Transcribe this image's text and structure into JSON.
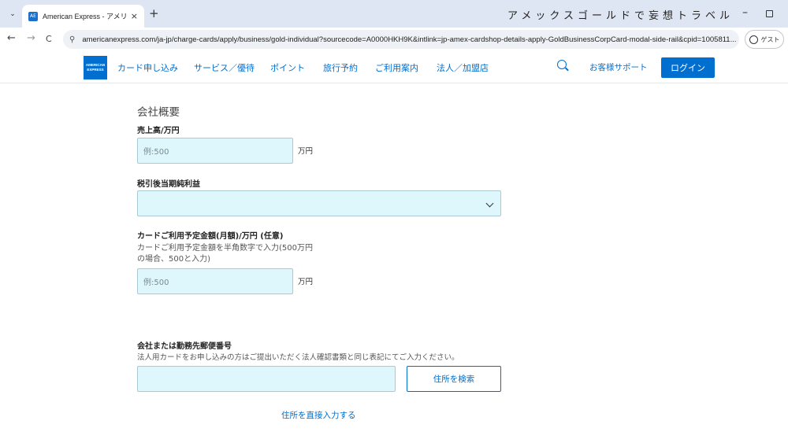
{
  "browser": {
    "tab_title": "American Express - アメリカン･エ",
    "favicon_text": "AE",
    "tab_close": "×",
    "new_tab": "+",
    "banner_text": "アメックスゴールドで妄想トラベル",
    "url": "americanexpress.com/ja-jp/charge-cards/apply/business/gold-individual?sourcecode=A0000HKH9K&intlink=jp-amex-cardshop-details-apply-GoldBusinessCorpCard-modal-side-rail&cpid=1005811...",
    "guest_label": "ゲスト",
    "win_min": "–",
    "back": "←",
    "forward": "→",
    "reload": "C",
    "tab_menu": "⌄",
    "tune": "⚲"
  },
  "header": {
    "logo_line1": "AMERICAN",
    "logo_line2": "EXPRESS",
    "nav": [
      "カード申し込み",
      "サービス／優待",
      "ポイント",
      "旅行予約",
      "ご利用案内",
      "法人／加盟店"
    ],
    "support": "お客様サポート",
    "login": "ログイン"
  },
  "form": {
    "section_heading": "会社概要",
    "sales": {
      "label": "売上高/万円",
      "placeholder": "例:500",
      "unit": "万円"
    },
    "net_income": {
      "label": "税引後当期純利益",
      "value": ""
    },
    "card_usage": {
      "label": "カードご利用予定金額(月額)/万円 (任意)",
      "hint_line1": "カードご利用予定金額を半角数字で入力(500万円",
      "hint_line2": "の場合、500と入力)",
      "placeholder": "例:500",
      "unit": "万円"
    },
    "postal": {
      "label": "会社または勤務先郵便番号",
      "hint": "法人用カードをお申し込みの方はご提出いただく法人確認書類と同じ表記にてご入力ください。",
      "value": "",
      "search_button": "住所を検索"
    },
    "direct_input_link": "住所を直接入力する"
  },
  "colors": {
    "accent": "#006fcf",
    "input_bg": "#def7fc",
    "tabstrip": "#dfe6f3"
  },
  "icons": [
    "tab-menu-icon",
    "close-icon",
    "new-tab-icon",
    "back-icon",
    "forward-icon",
    "reload-icon",
    "site-settings-icon",
    "guest-profile-icon",
    "search-icon",
    "chevron-down-icon"
  ]
}
